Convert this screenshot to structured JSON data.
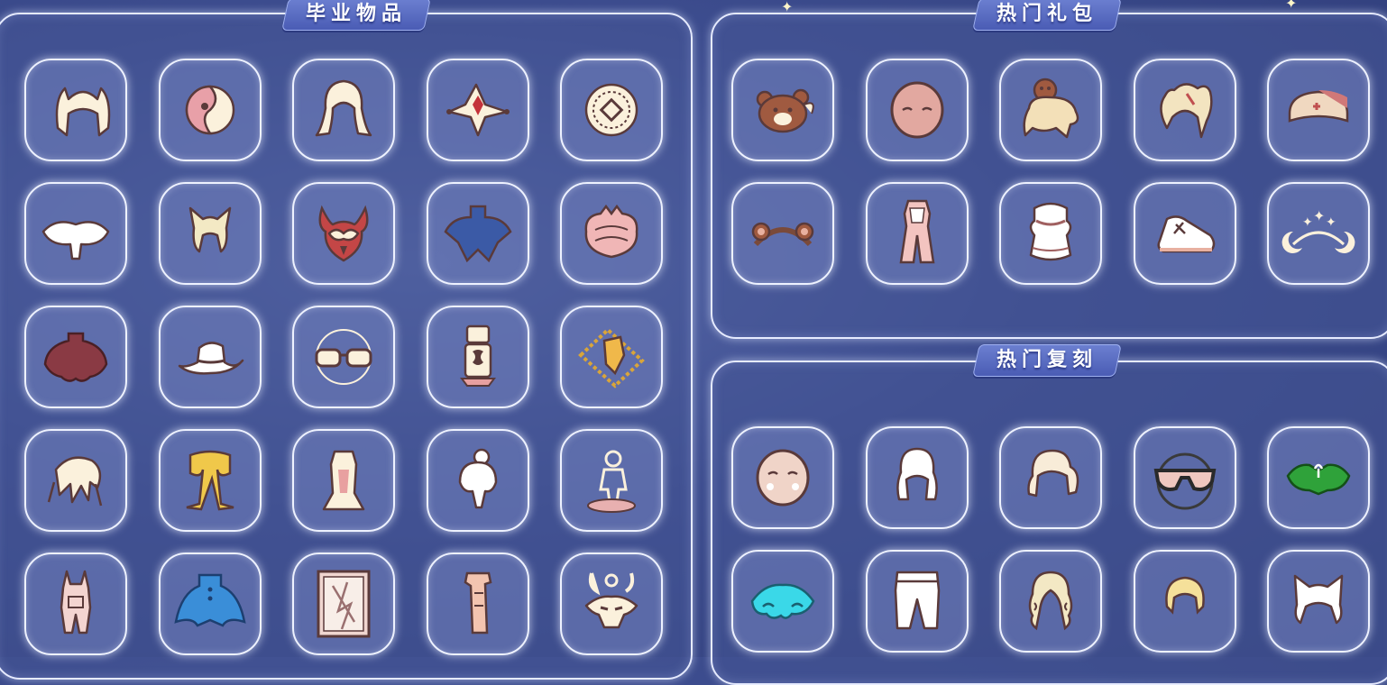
{
  "sections": {
    "graduation": {
      "title": "毕业物品"
    },
    "hot_packs": {
      "title": "热门礼包"
    },
    "hot_reruns": {
      "title": "热门复刻"
    }
  },
  "colors": {
    "background": "#3d4d8f",
    "panel_border": "#e6ebff",
    "title_badge": "#5a6dc4",
    "item_cream": "#fbf1dc",
    "item_outline": "#5a3a3a"
  },
  "graduation_items": [
    "cat-ear-hair-icon",
    "half-mask-icon",
    "long-hair-icon",
    "jester-collar-icon",
    "round-emblem-icon",
    "white-cape-icon",
    "fox-ear-hair-icon",
    "owl-mask-icon",
    "blue-cape-icon",
    "pink-shell-cape-icon",
    "maroon-fur-cape-icon",
    "cowboy-hat-icon",
    "round-glasses-icon",
    "lantern-prop-icon",
    "golden-crystal-necklace-icon",
    "feather-hair-icon",
    "golden-scarf-icon",
    "white-robe-icon",
    "bun-hair-icon",
    "statue-prop-icon",
    "bunny-outfit-icon",
    "blue-cape-buttons-icon",
    "framed-picture-icon",
    "tall-scarf-icon",
    "antler-mask-icon"
  ],
  "hot_pack_items": [
    "bear-hat-icon",
    "pink-face-mask-icon",
    "beige-creature-prop-icon",
    "twin-tail-hair-icon",
    "nurse-cap-icon",
    "bear-ear-headband-icon",
    "pink-pants-outfit-icon",
    "fluffy-outfit-icon",
    "sneaker-prop-icon",
    "moon-star-crown-icon"
  ],
  "hot_rerun_items": [
    "round-face-mask-icon",
    "braided-hair-icon",
    "ponytail-hair-icon",
    "sunglasses-icon",
    "green-leaf-cape-icon",
    "cyan-cloud-cape-icon",
    "white-pants-icon",
    "curly-long-hair-icon",
    "short-blonde-hair-icon",
    "cat-ear-bob-hair-icon"
  ]
}
